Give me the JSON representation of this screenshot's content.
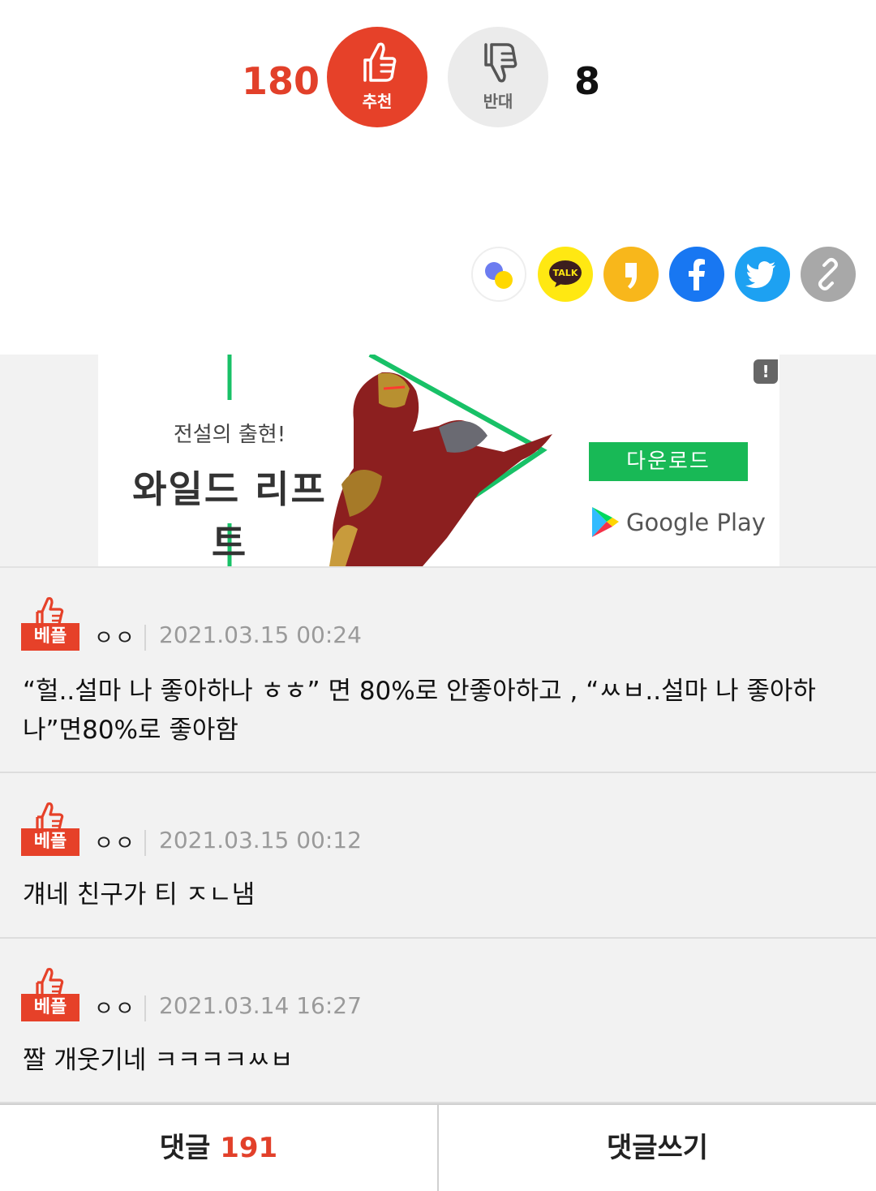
{
  "vote": {
    "up_count": "180",
    "up_label": "추천",
    "down_label": "반대",
    "down_count": "8"
  },
  "colors": {
    "accent": "#e64129",
    "kakao_yellow": "#ffe812",
    "story_yellow": "#f8b71b",
    "facebook_blue": "#1877f2",
    "twitter_blue": "#1da1f2",
    "ad_green": "#18b956"
  },
  "share": {
    "icons": [
      "band-icon",
      "kakaotalk-icon",
      "kakaostory-icon",
      "facebook-icon",
      "twitter-icon",
      "link-icon"
    ],
    "kakao_label": "TALK"
  },
  "ad": {
    "subtitle": "전설의 출현!",
    "title": "와일드 리프트",
    "download_label": "다운로드",
    "store_label": "Google Play",
    "info_badge": "!"
  },
  "comments": [
    {
      "badge": "베플",
      "nickname": "ㅇㅇ",
      "date": "2021.03.15 00:24",
      "text": "“헐..설마 나 좋아하나 ㅎㅎ” 면 80%로 안좋아하고 , “ㅆㅂ..설마 나 좋아하나”면80%로 좋아함"
    },
    {
      "badge": "베플",
      "nickname": "ㅇㅇ",
      "date": "2021.03.15 00:12",
      "text": "걔네 친구가 티 ㅈㄴ냄"
    },
    {
      "badge": "베플",
      "nickname": "ㅇㅇ",
      "date": "2021.03.14 16:27",
      "text": "짤 개웃기네 ㅋㅋㅋㅋㅆㅂ"
    }
  ],
  "bottom_bar": {
    "comments_label": "댓글",
    "comments_count": "191",
    "write_label": "댓글쓰기"
  }
}
